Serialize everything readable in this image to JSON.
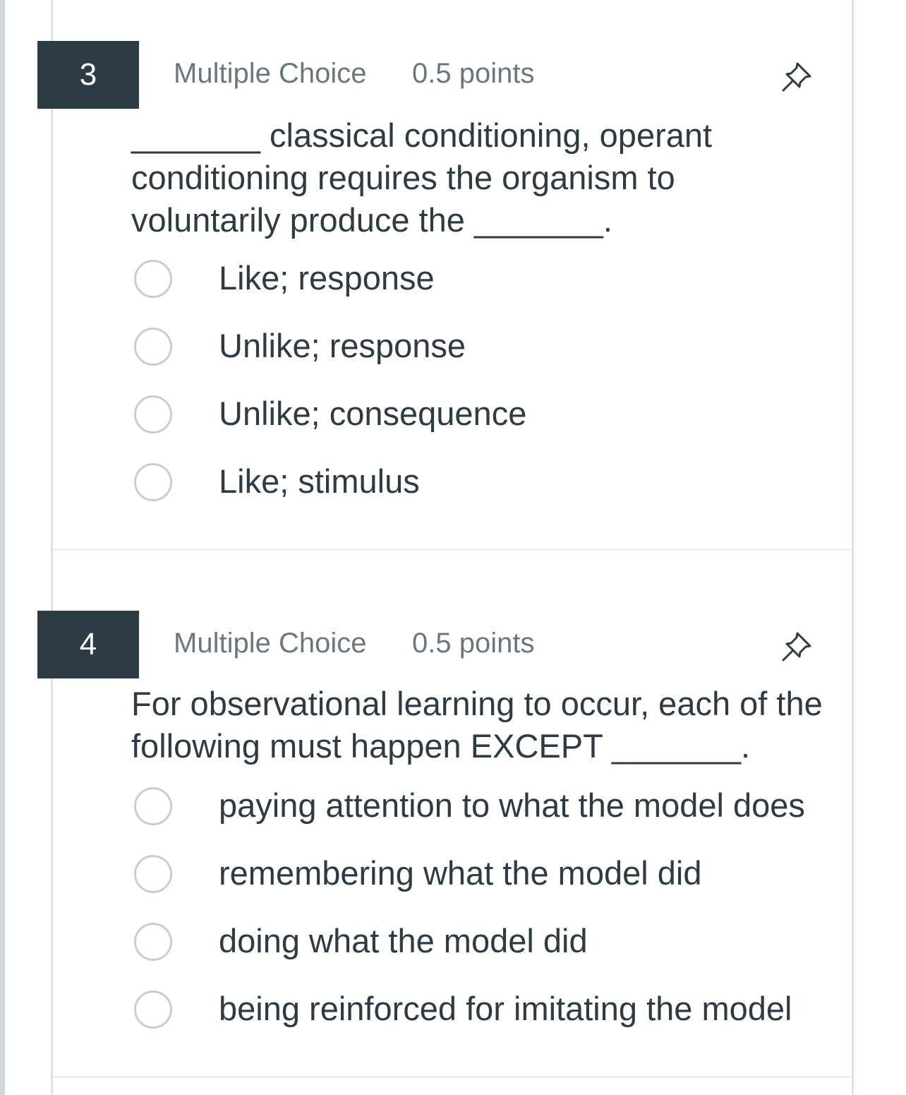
{
  "questions": [
    {
      "number": "3",
      "type": "Multiple Choice",
      "points": "0.5 points",
      "text": "_______ classical conditioning, operant conditioning requires the organism to voluntarily produce the _______.",
      "options": [
        "Like; response",
        "Unlike; response",
        "Unlike; consequence",
        "Like; stimulus"
      ]
    },
    {
      "number": "4",
      "type": "Multiple Choice",
      "points": "0.5 points",
      "text": "For observational learning to occur, each of the following must happen EXCEPT _______.",
      "options": [
        "paying attention to what the model does",
        "remembering what the model did",
        "doing what the model did",
        "being reinforced for imitating the model"
      ]
    }
  ],
  "icons": {
    "pin": "pushpin-icon"
  },
  "colors": {
    "number_badge_bg": "#2d3b45",
    "text": "#2d3b45",
    "meta_text": "#6b7780",
    "radio_border": "#c7cdd1"
  }
}
